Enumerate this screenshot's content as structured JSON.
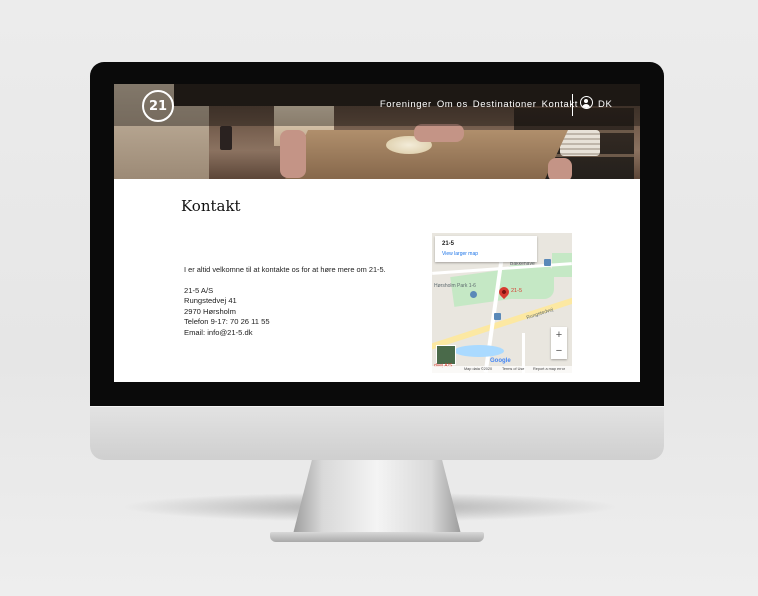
{
  "nav": {
    "logo": "21",
    "items": [
      "Foreninger",
      "Om os",
      "Destinationer",
      "Kontakt"
    ],
    "language": "DK"
  },
  "page": {
    "title": "Kontakt",
    "intro": "I er altid velkomne til at kontakte os for at høre mere om 21-5.",
    "address_lines": [
      "21-5 A/S",
      "Rungstedvej 41",
      "2970 Hørsholm",
      "Telefon 9-17: 70 26 11 55",
      "Email: info@21-5.dk"
    ]
  },
  "map": {
    "card_title": "21-5",
    "card_link": "View larger map",
    "pin_label": "21-5",
    "labels": {
      "park": "Hørsholm Park 1-6",
      "street": "Rungstedvej",
      "street2": "Bakkehave"
    },
    "zoom_in": "+",
    "zoom_out": "−",
    "google": "Google",
    "partial_label": "dvej A/S",
    "attribution": {
      "data": "Map data ©2020",
      "terms": "Terms of Use",
      "report": "Report a map error"
    }
  }
}
